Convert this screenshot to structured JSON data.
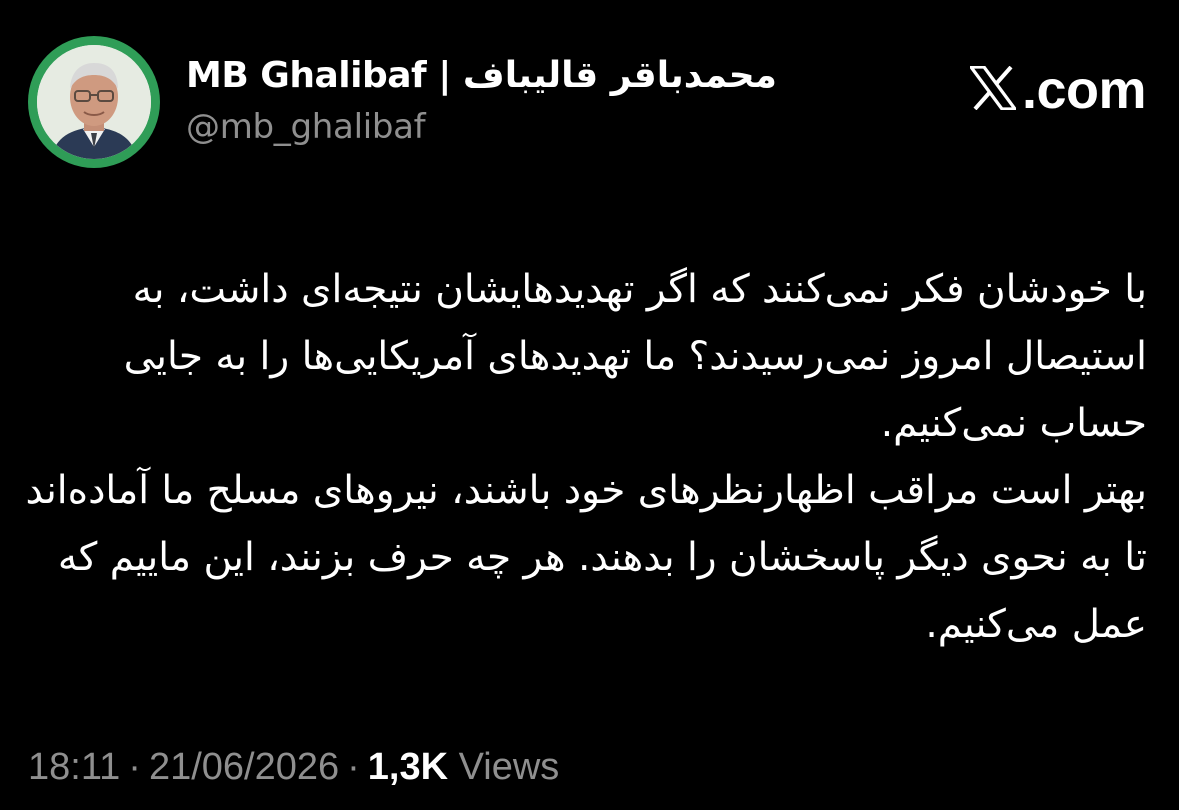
{
  "author": {
    "display_name_latin": "MB Ghalibaf |",
    "display_name_persian": "محمدباقر قالیباف",
    "handle": "@mb_ghalibaf",
    "avatar_icon": "profile-photo",
    "avatar_ring_color": "#2f9d57"
  },
  "brand": {
    "logo_icon": "x-logo-icon",
    "label": ".com"
  },
  "tweet": {
    "paragraphs": [
      "با خودشان فکر نمی‌کنند که اگر تهدیدهایشان نتیجه‌ای داشت، به استیصال امروز نمی‌رسیدند؟ ما تهدیدهای آمریکایی‌ها را به جایی حساب نمی‌کنیم.",
      "بهتر است مراقب اظهارنظرهای خود باشند، نیروهای مسلح ما آماده‌اند تا به نحوی دیگر پاسخشان را بدهند. هر چه حرف بزنند، این ماییم که عمل می‌کنیم."
    ]
  },
  "meta": {
    "time": "18:11",
    "date": "21/06/2026",
    "views_count": "1,3K",
    "views_label": "Views"
  },
  "colors": {
    "background": "#000000",
    "text_primary": "#ffffff",
    "text_secondary": "#8f8f8f"
  }
}
